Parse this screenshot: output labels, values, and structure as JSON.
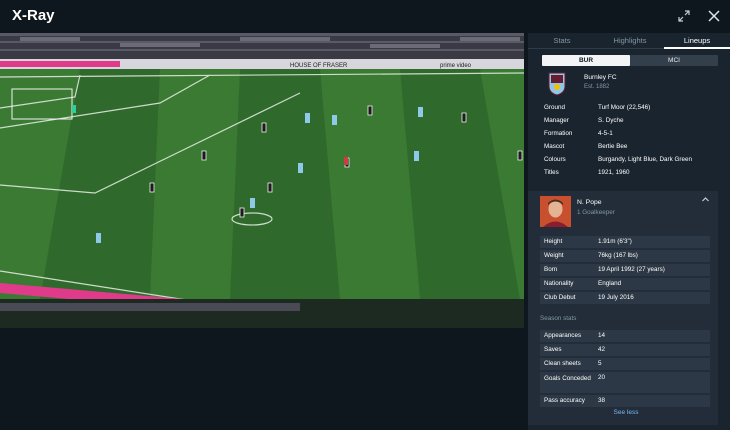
{
  "window": {
    "title": "X-Ray",
    "minimize_icon": "collapse-arrows-icon",
    "close_icon": "close-icon"
  },
  "video": {
    "description_colors": {
      "pitch": "#2f6a2c",
      "pitch_stripe": "#3a7a33"
    },
    "hoardings": [
      "HOUSE OF FRASER",
      "HOUSE OF FRASER",
      "prime video",
      "HOUSE OF FRASER"
    ]
  },
  "tabs": [
    {
      "label": "Stats",
      "active": false
    },
    {
      "label": "Highlights",
      "active": false
    },
    {
      "label": "Lineups",
      "active": true
    }
  ],
  "team_toggle": {
    "left": "BUR",
    "right": "MCI",
    "active": "BUR"
  },
  "club": {
    "name": "Burnley FC",
    "established": "Est. 1882",
    "info": [
      {
        "key": "Ground",
        "value": "Turf Moor (22,546)"
      },
      {
        "key": "Manager",
        "value": "S. Dyche"
      },
      {
        "key": "Formation",
        "value": "4-5-1"
      },
      {
        "key": "Mascot",
        "value": "Bertie Bee"
      },
      {
        "key": "Colours",
        "value": "Burgandy, Light Blue, Dark Green"
      },
      {
        "key": "Titles",
        "value": "1921, 1960"
      }
    ]
  },
  "player": {
    "name": "N. Pope",
    "position": "1 Goalkeeper",
    "details": [
      {
        "key": "Height",
        "value": "1.91m (6'3\")"
      },
      {
        "key": "Weight",
        "value": "76kg (167 lbs)"
      },
      {
        "key": "Born",
        "value": "19 April 1992 (27 years)"
      },
      {
        "key": "Nationality",
        "value": "England"
      },
      {
        "key": "Club Debut",
        "value": "19 July 2016"
      }
    ],
    "season_label": "Season stats",
    "season_stats": [
      {
        "key": "Appearances",
        "value": "14"
      },
      {
        "key": "Saves",
        "value": "42"
      },
      {
        "key": "Clean sheets",
        "value": "5"
      },
      {
        "key": "Goals Conceded",
        "value": "20"
      },
      {
        "key": "Pass accuracy",
        "value": "38"
      }
    ],
    "see_less": "See less"
  }
}
